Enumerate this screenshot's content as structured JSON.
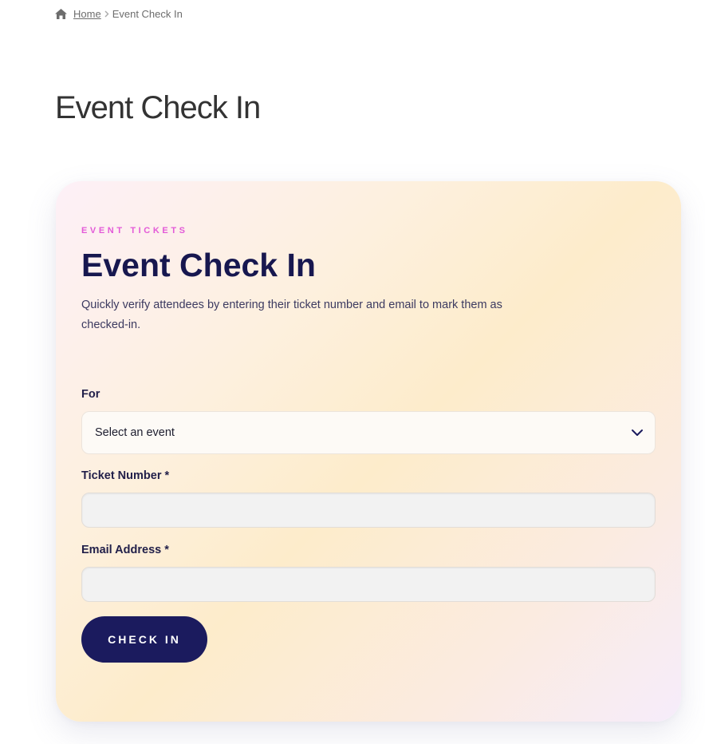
{
  "breadcrumb": {
    "home_icon": "home-icon",
    "home_label": "Home",
    "separator_icon": "chevron-right-icon",
    "current": "Event Check In"
  },
  "page": {
    "title": "Event Check In"
  },
  "card": {
    "eyebrow": "EVENT TICKETS",
    "title": "Event Check In",
    "description": "Quickly verify attendees by entering their ticket number and email to mark them as checked-in.",
    "gradient_colors": [
      "#fdf0f7",
      "#fdeccb",
      "#f6ecfb"
    ]
  },
  "form": {
    "event_label": "For",
    "event_selected": "Select an event",
    "event_dropdown_icon": "chevron-down-icon",
    "ticket_label": "Ticket Number *",
    "ticket_value": "",
    "email_label": "Email Address *",
    "email_value": "",
    "submit_label": "CHECK IN"
  },
  "colors": {
    "accent_pink": "#e35ad8",
    "title_navy": "#17174f",
    "button_bg": "#1b1b5e"
  }
}
